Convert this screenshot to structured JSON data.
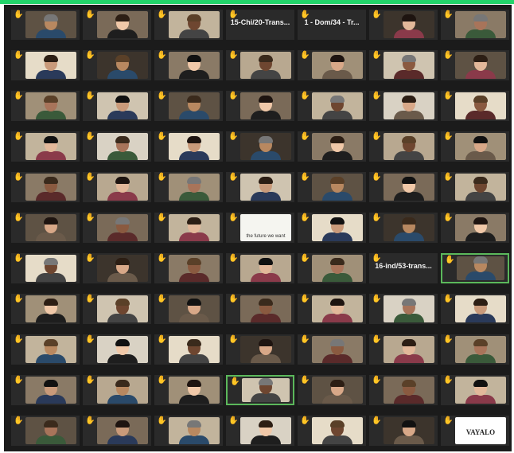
{
  "colors": {
    "top_bar": "#22d46a",
    "gallery_bg": "#1b1b1b",
    "tile_bg": "#2a2a2a",
    "active_border": "#5bb85b",
    "raise_hand": "#f4c430"
  },
  "tile_name_labels": [
    {
      "row": 0,
      "col": 3,
      "label": "15-Chi/20-Trans..."
    },
    {
      "row": 0,
      "col": 4,
      "label": "1 - Dom/34 - Tr..."
    },
    {
      "row": 6,
      "col": 5,
      "label": "16-ind/53-trans..."
    }
  ],
  "logo_text": "VAYALO",
  "banner_text": "the future we want",
  "raise_hand_icon": "raised-hand-icon",
  "grid": {
    "rows": 11,
    "cols": 7
  }
}
